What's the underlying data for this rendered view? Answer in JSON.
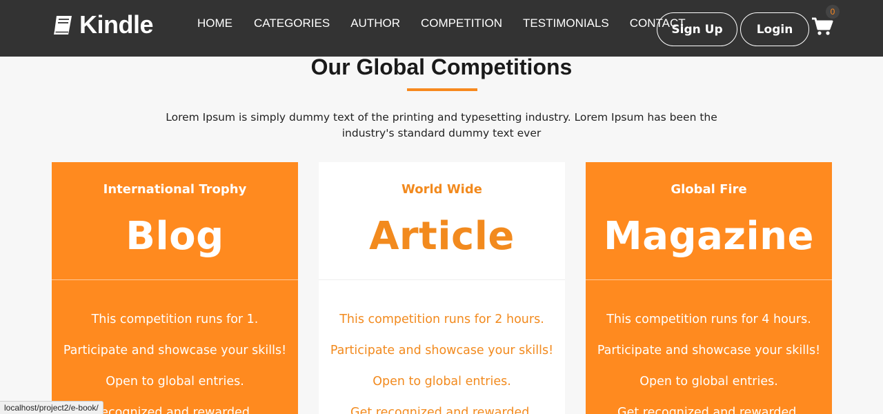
{
  "brand": {
    "name": "Kindle",
    "icon": "book-icon"
  },
  "nav": {
    "items": [
      {
        "label": "HOME"
      },
      {
        "label": "CATEGORIES"
      },
      {
        "label": "AUTHOR"
      },
      {
        "label": "COMPETITION"
      },
      {
        "label": "TESTIMONIALS"
      },
      {
        "label": "CONTACT"
      }
    ]
  },
  "auth": {
    "signup_label": "Sign Up",
    "login_label": "Login"
  },
  "cart": {
    "icon": "cart-icon",
    "count": "0"
  },
  "section": {
    "title": "Our Global Competitions",
    "description": "Lorem Ipsum is simply dummy text of the printing and typesetting industry. Lorem Ipsum has been the industry's standard dummy text ever"
  },
  "cards": [
    {
      "kicker": "International Trophy",
      "title": "Blog",
      "lines": [
        "This competition runs for 1.",
        "Participate and showcase your skills!",
        "Open to global entries.",
        "recognized and rewarded."
      ]
    },
    {
      "kicker": "World Wide",
      "title": "Article",
      "lines": [
        "This competition runs for 2 hours.",
        "Participate and showcase your skills!",
        "Open to global entries.",
        "Get recognized and rewarded."
      ]
    },
    {
      "kicker": "Global Fire",
      "title": "Magazine",
      "lines": [
        "This competition runs for 4 hours.",
        "Participate and showcase your skills!",
        "Open to global entries.",
        "Get recognized and rewarded."
      ]
    }
  ],
  "status_bar": {
    "url": "localhost/project2/e-book/"
  },
  "colors": {
    "accent": "#ff8a1f",
    "header_bg": "#333333",
    "page_bg": "#f7f7f7"
  }
}
